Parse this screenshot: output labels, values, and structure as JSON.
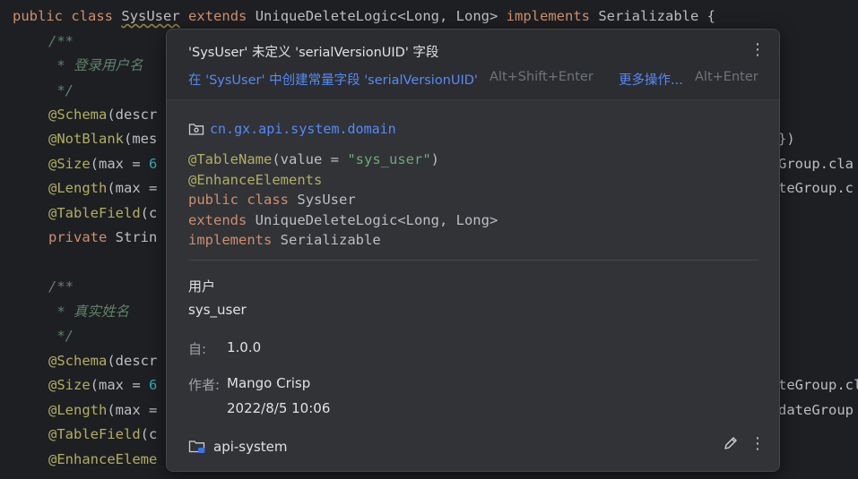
{
  "code": {
    "l1": {
      "kw1": "public",
      "kw2": "class",
      "cls": "SysUser",
      "kw3": "extends",
      "base": "UniqueDeleteLogic<Long, Long>",
      "kw4": "implements",
      "iface": "Serializable {"
    },
    "l2": "/**",
    "l3": " * 登录用户名",
    "l4": " */",
    "l5_ann": "@Schema",
    "l5_rest": "(descr",
    "l6_ann": "@NotBlank",
    "l6_rest": "(mes",
    "l6_right": "})",
    "l7_ann": "@Size",
    "l7_rest": "(max = ",
    "l7_num": "6",
    "l7_right": "Group.cla",
    "l8_ann": "@Length",
    "l8_rest": "(max =",
    "l8_right": "teGroup.c",
    "l9_ann": "@TableField",
    "l9_rest": "(c",
    "l10_kw": "private",
    "l10_rest": " Strin",
    "l12": "/**",
    "l13": " * 真实姓名",
    "l14": " */",
    "l15_ann": "@Schema",
    "l15_rest": "(descr",
    "l16_ann": "@Size",
    "l16_rest": "(max = ",
    "l16_num": "6",
    "l16_right": "teGroup.cl",
    "l17_ann": "@Length",
    "l17_rest": "(max =",
    "l17_right": "dateGroup",
    "l18_ann": "@TableField",
    "l18_rest": "(c",
    "l19_ann": "@EnhanceEleme"
  },
  "popup": {
    "title": "'SysUser' 未定义 'serialVersionUID' 字段",
    "fix_action": "在 'SysUser' 中创建常量字段 'serialVersionUID'",
    "fix_shortcut": "Alt+Shift+Enter",
    "more_actions": "更多操作...",
    "more_shortcut": "Alt+Enter",
    "more_glyph": "⋮",
    "package": "cn.gx.api.system.domain",
    "sig": {
      "ann1": "@TableName",
      "ann1_open": "(value = ",
      "ann1_str": "\"sys_user\"",
      "ann1_close": ")",
      "ann2": "@EnhanceElements",
      "kw_public": "public",
      "kw_class": "class",
      "cls": "SysUser",
      "kw_extends": "extends",
      "base": "UniqueDeleteLogic<Long, Long>",
      "kw_implements": "implements",
      "iface": "Serializable"
    },
    "desc_line1": "用户",
    "desc_line2": "sys_user",
    "since_label": "自:",
    "since_value": "1.0.0",
    "author_label": "作者:",
    "author_value": "Mango Crisp",
    "author_date": "2022/8/5 10:06",
    "module": "api-system"
  }
}
